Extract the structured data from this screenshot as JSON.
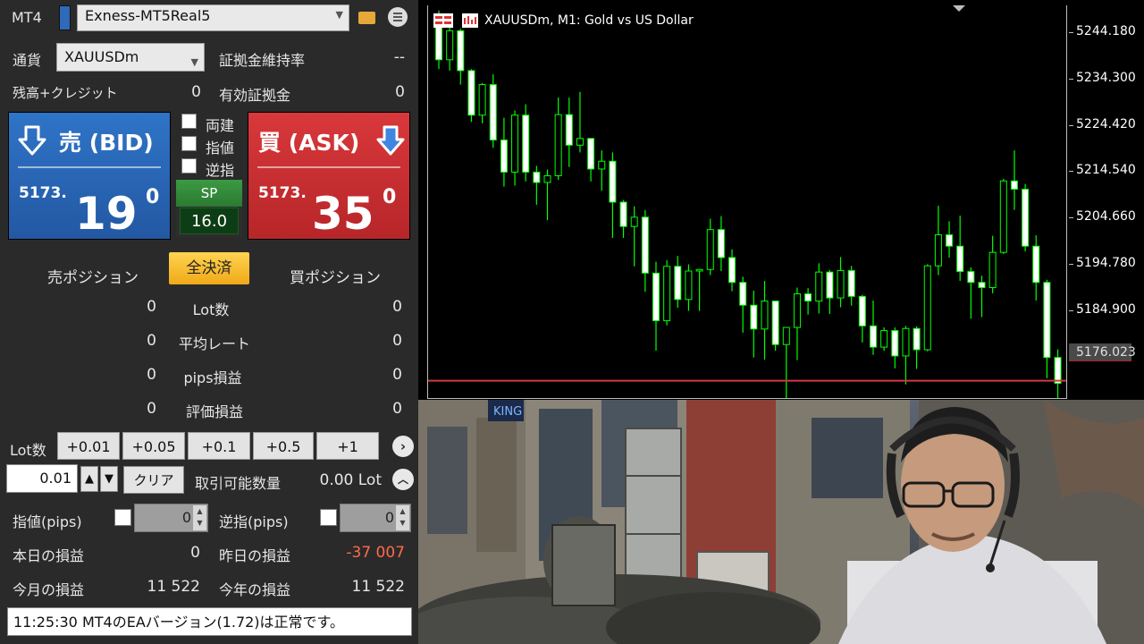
{
  "panel": {
    "app_label": "MT4",
    "account": "Exness-MT5Real5",
    "currency_label": "通貨",
    "symbol": "XAUUSDm",
    "margin_level_label": "証拠金維持率",
    "margin_level_value": "--",
    "balance_label": "残高+クレジット",
    "balance_value": "0",
    "equity_label": "有効証拠金",
    "equity_value": "0",
    "sell_title": "売 (BID)",
    "sell_price_small": "5173.",
    "sell_price_big": "19",
    "sell_price_sup": "0",
    "buy_title": "買 (ASK)",
    "buy_price_small": "5173.",
    "buy_price_big": "35",
    "buy_price_sup": "0",
    "chk_hedge": "両建",
    "chk_limit": "指値",
    "chk_stop": "逆指",
    "sp_label": "SP",
    "sp_value": "16.0",
    "sell_position_label": "売ポジション",
    "close_all_label": "全決済",
    "buy_position_label": "買ポジション",
    "rows": [
      {
        "label": "Lot数",
        "sell": "0",
        "buy": "0"
      },
      {
        "label": "平均レート",
        "sell": "0",
        "buy": "0"
      },
      {
        "label": "pips損益",
        "sell": "0",
        "buy": "0"
      },
      {
        "label": "評価損益",
        "sell": "0",
        "buy": "0"
      }
    ],
    "lot_label": "Lot数",
    "lot_buttons": [
      "+0.01",
      "+0.05",
      "+0.1",
      "+0.5",
      "+1"
    ],
    "lot_value": "0.01",
    "clear_label": "クリア",
    "tradable_label": "取引可能数量",
    "tradable_value": "0.00 Lot",
    "limit_pips_label": "指値(pips)",
    "limit_pips_value": "0",
    "stop_pips_label": "逆指(pips)",
    "stop_pips_value": "0",
    "today_pl_label": "本日の損益",
    "today_pl_value": "0",
    "yesterday_pl_label": "昨日の損益",
    "yesterday_pl_value": "-37 007",
    "month_pl_label": "今月の損益",
    "month_pl_value": "11 522",
    "year_pl_label": "今年の損益",
    "year_pl_value": "11 522",
    "status_message": "11:25:30 MT4のEAバージョン(1.72)は正常です。",
    "colors": {
      "bid": "#2a66b8",
      "ask": "#c52e31",
      "loss": "#ff6a4d",
      "close_all": "#f5b82a"
    }
  },
  "chart_data": {
    "type": "candlestick",
    "title": "XAUUSDm, M1:  Gold vs US Dollar",
    "y_ticks": [
      "5244.180",
      "5234.300",
      "5224.420",
      "5214.540",
      "5204.660",
      "5194.780",
      "5184.900"
    ],
    "ylim": [
      5172.5,
      5248.5
    ],
    "current_price": "5176.023",
    "current_price_value": 5176.023,
    "candle_color": "#00ff00",
    "price_line_color": "#d0393f",
    "candles": [
      [
        5244.9,
        5247.5,
        5236.2,
        5238.0
      ],
      [
        5238.0,
        5244.5,
        5235.9,
        5243.6
      ],
      [
        5243.6,
        5244.0,
        5233.2,
        5235.9
      ],
      [
        5235.9,
        5236.2,
        5226.0,
        5227.3
      ],
      [
        5227.3,
        5233.5,
        5225.7,
        5233.2
      ],
      [
        5233.2,
        5235.2,
        5221.0,
        5222.5
      ],
      [
        5222.5,
        5226.8,
        5213.5,
        5216.3
      ],
      [
        5216.3,
        5228.2,
        5213.7,
        5227.3
      ],
      [
        5227.3,
        5229.4,
        5214.5,
        5216.3
      ],
      [
        5216.3,
        5217.5,
        5210.0,
        5214.3
      ],
      [
        5214.3,
        5216.8,
        5207.0,
        5215.6
      ],
      [
        5215.6,
        5230.7,
        5214.8,
        5227.4
      ],
      [
        5227.4,
        5230.7,
        5217.3,
        5221.5
      ],
      [
        5221.5,
        5231.8,
        5220.1,
        5222.8
      ],
      [
        5222.8,
        5222.8,
        5214.5,
        5216.9
      ],
      [
        5216.9,
        5220.5,
        5212.7,
        5218.4
      ],
      [
        5218.4,
        5220.1,
        5203.6,
        5210.5
      ],
      [
        5210.5,
        5210.9,
        5203.6,
        5205.8
      ],
      [
        5205.8,
        5209.7,
        5198.1,
        5207.6
      ],
      [
        5207.6,
        5209.0,
        5193.2,
        5196.8
      ],
      [
        5196.8,
        5199.0,
        5181.8,
        5187.6
      ],
      [
        5187.6,
        5199.3,
        5186.7,
        5198.1
      ],
      [
        5198.1,
        5200.1,
        5190.1,
        5191.7
      ],
      [
        5191.7,
        5198.5,
        5189.5,
        5197.2
      ],
      [
        5197.2,
        5197.6,
        5189.5,
        5197.5
      ],
      [
        5197.5,
        5207.3,
        5196.4,
        5205.2
      ],
      [
        5205.2,
        5207.8,
        5197.2,
        5199.8
      ],
      [
        5199.8,
        5201.4,
        5193.3,
        5195.0
      ],
      [
        5195.0,
        5196.1,
        5185.3,
        5190.6
      ],
      [
        5190.6,
        5193.4,
        5180.5,
        5186.0
      ],
      [
        5186.0,
        5195.3,
        5180.1,
        5191.4
      ],
      [
        5191.4,
        5191.4,
        5181.8,
        5183.0
      ],
      [
        5183.0,
        5185.4,
        5162.5,
        5186.3
      ],
      [
        5186.3,
        5194.0,
        5180.0,
        5192.8
      ],
      [
        5192.8,
        5193.9,
        5188.8,
        5191.4
      ],
      [
        5191.4,
        5198.7,
        5189.0,
        5197.0
      ],
      [
        5197.0,
        5197.4,
        5188.9,
        5192.0
      ],
      [
        5192.0,
        5199.9,
        5190.2,
        5197.3
      ],
      [
        5197.3,
        5198.2,
        5190.5,
        5192.3
      ],
      [
        5192.3,
        5192.6,
        5183.4,
        5186.6
      ],
      [
        5186.6,
        5191.5,
        5181.0,
        5182.5
      ],
      [
        5182.5,
        5186.3,
        5181.8,
        5185.7
      ],
      [
        5185.7,
        5186.3,
        5178.4,
        5180.8
      ],
      [
        5180.8,
        5186.6,
        5175.3,
        5186.1
      ],
      [
        5186.1,
        5186.5,
        5178.3,
        5182.0
      ],
      [
        5182.0,
        5198.5,
        5181.7,
        5198.2
      ],
      [
        5198.2,
        5209.8,
        5196.4,
        5204.2
      ],
      [
        5204.2,
        5206.8,
        5199.8,
        5202.0
      ],
      [
        5202.0,
        5207.9,
        5195.3,
        5197.1
      ],
      [
        5197.1,
        5197.9,
        5188.0,
        5195.0
      ],
      [
        5195.0,
        5196.3,
        5188.3,
        5194.0
      ],
      [
        5194.0,
        5204.0,
        5192.9,
        5200.8
      ],
      [
        5200.8,
        5215.0,
        5200.5,
        5214.6
      ],
      [
        5214.6,
        5220.5,
        5209.0,
        5213.0
      ],
      [
        5213.0,
        5214.0,
        5201.0,
        5202.0
      ],
      [
        5202.0,
        5204.1,
        5191.5,
        5195.0
      ],
      [
        5195.0,
        5195.5,
        5176.5,
        5180.5
      ],
      [
        5180.5,
        5182.1,
        5171.2,
        5175.5
      ]
    ]
  }
}
